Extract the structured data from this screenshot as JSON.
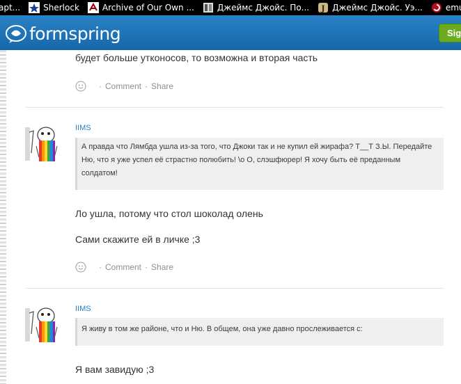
{
  "bookmarks": [
    {
      "label": "apt...",
      "icon": "page-icon"
    },
    {
      "label": "Sherlock",
      "icon": "star-icon"
    },
    {
      "label": "Archive of Our Own ...",
      "icon": "ao3-icon"
    },
    {
      "label": "Джеймс Джойс. По...",
      "icon": "book-icon"
    },
    {
      "label": "Джеймс Джойс. Уэ...",
      "icon": "j-icon"
    },
    {
      "label": "emungere | Fi",
      "icon": "swirl-icon"
    }
  ],
  "header": {
    "logo_text": "formspring",
    "signup_label": "Sig"
  },
  "posts": [
    {
      "answer_lines": [
        "будет больше утконосов, то возможна и вторая часть"
      ],
      "comment_label": "Comment",
      "share_label": "Share"
    },
    {
      "username": "IIMS",
      "question": "А правда что Лямбда ушла из-за того, что Джоки так и не купил ей жирафа? Т__Т З.Ы. Передайте Ню, что я уже успел её страстно полюбить! \\о О, слэшфюрер! Я хочу быть её преданным солдатом!",
      "answer_lines": [
        "Ло ушла, потому что стол шоколад олень",
        "Сами скажите ей в личке ;3"
      ],
      "comment_label": "Comment",
      "share_label": "Share"
    },
    {
      "username": "IIMS",
      "question": "Я живу в том же районе, что и Ню. В общем, она уже давно прослеживается с:",
      "answer_lines": [
        "Я вам завидую ;3"
      ]
    }
  ],
  "colors": {
    "header_blue": "#1f75b8",
    "link_blue": "#2b7ec1",
    "signup_green": "#6cab1f",
    "action_gray": "#8e8e8e"
  }
}
